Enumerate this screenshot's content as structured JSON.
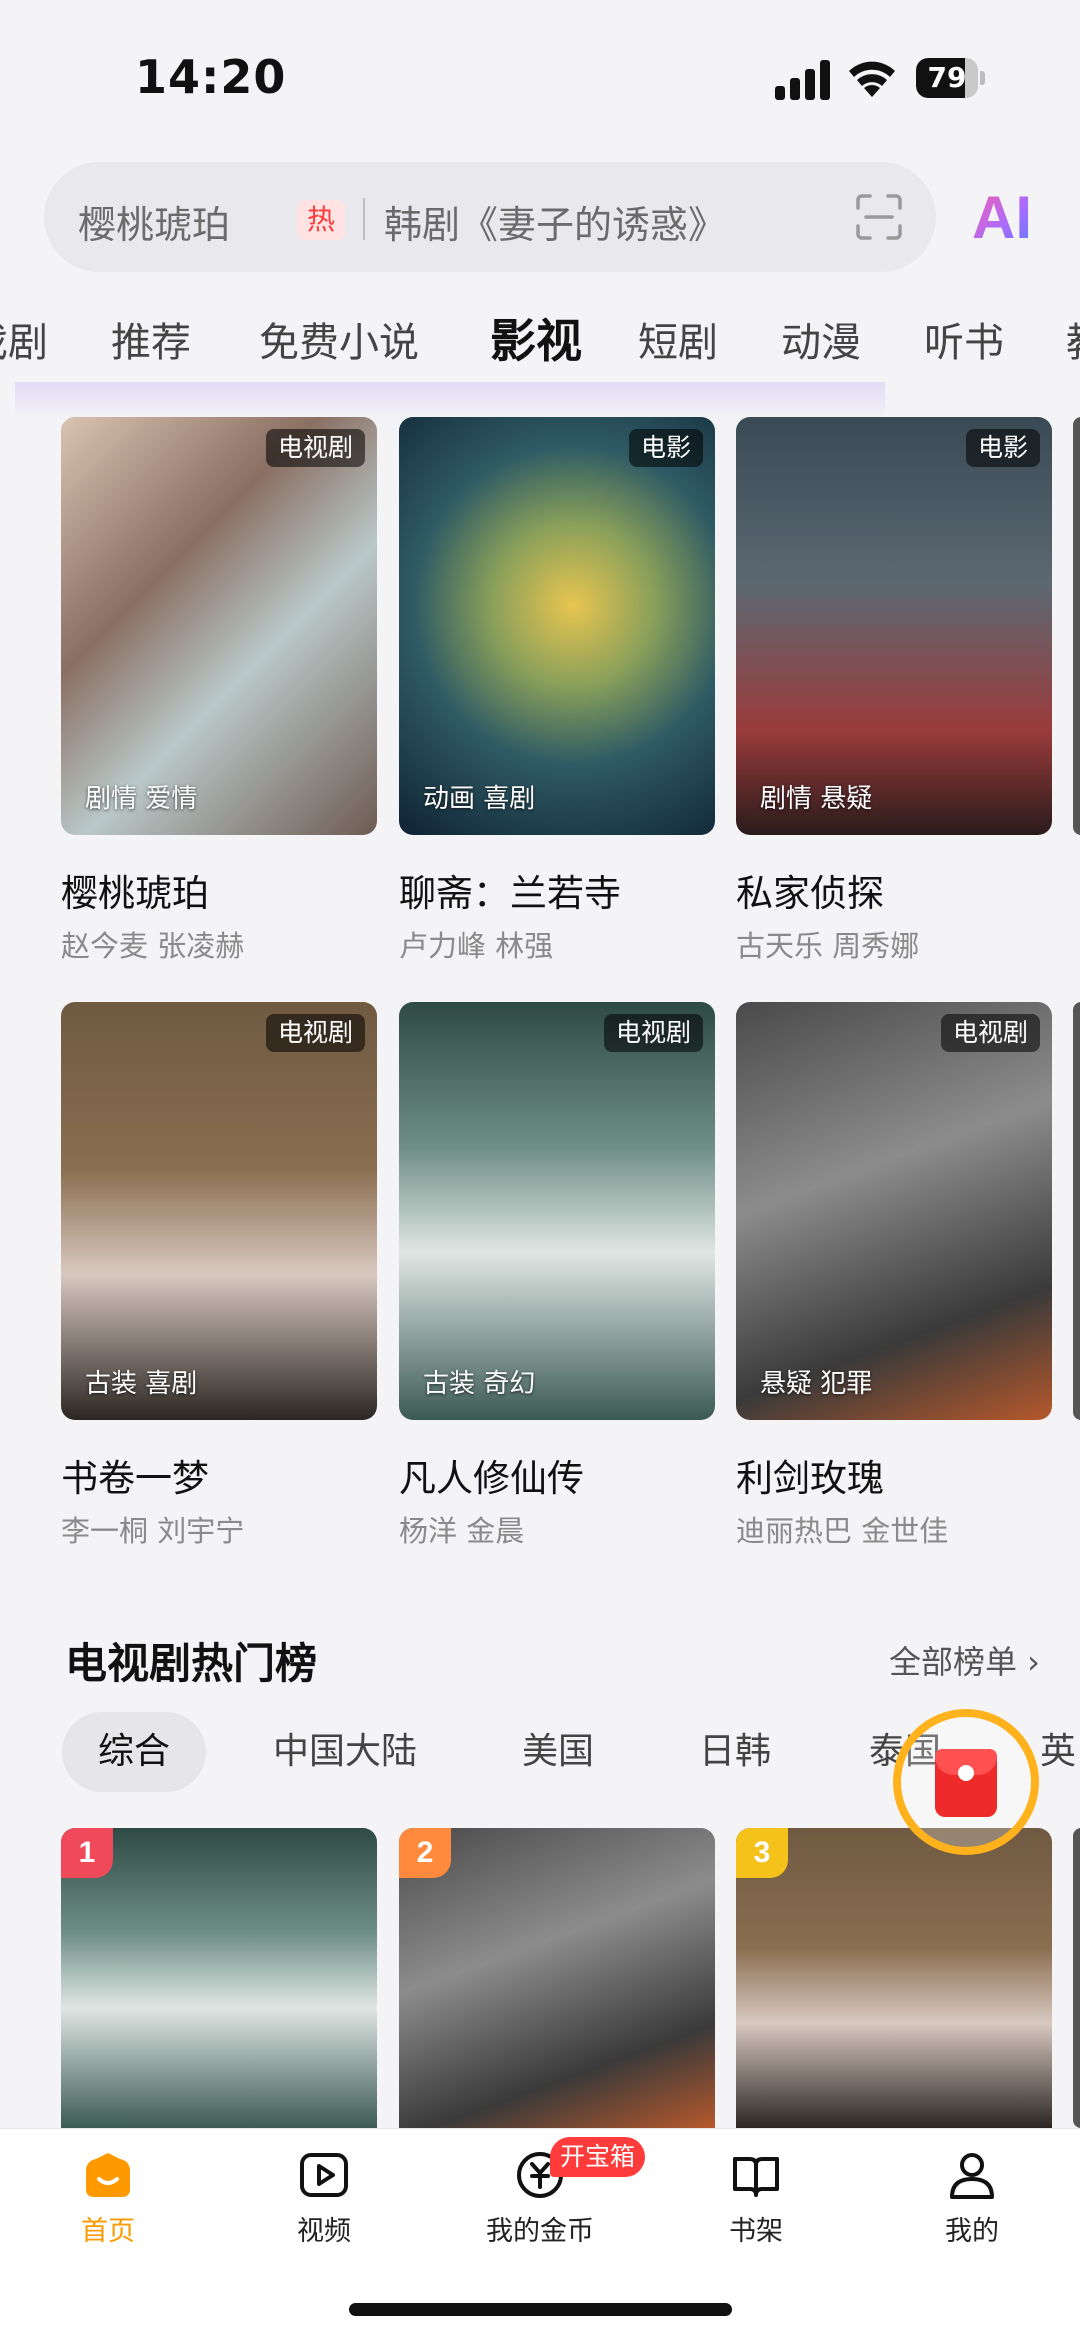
{
  "status_bar": {
    "time": "14:20",
    "battery": "79",
    "battery_level": 0.79
  },
  "search": {
    "main": "樱桃琥珀",
    "hot_badge": "热",
    "sub": "韩剧《妻子的诱惑》",
    "ai_label": "AI"
  },
  "tabs": [
    "戏剧",
    "推荐",
    "免费小说",
    "影视",
    "短剧",
    "动漫",
    "听书",
    "教"
  ],
  "tabs_active_index": 3,
  "cards": [
    {
      "badge": "电视剧",
      "genre": "剧情 爱情",
      "title": "樱桃琥珀",
      "cast": "赵今麦 张凌赫"
    },
    {
      "badge": "电影",
      "genre": "动画 喜剧",
      "title": "聊斋：兰若寺",
      "cast": "卢力峰 林强"
    },
    {
      "badge": "电影",
      "genre": "剧情 悬疑",
      "title": "私家侦探",
      "cast": "古天乐 周秀娜"
    },
    {
      "badge": "电视剧",
      "genre": "古装 喜剧",
      "title": "书卷一梦",
      "cast": "李一桐 刘宇宁"
    },
    {
      "badge": "电视剧",
      "genre": "古装 奇幻",
      "title": "凡人修仙传",
      "cast": "杨洋 金晨"
    },
    {
      "badge": "电视剧",
      "genre": "悬疑 犯罪",
      "title": "利剑玫瑰",
      "cast": "迪丽热巴 金世佳"
    }
  ],
  "ranking": {
    "title": "电视剧热门榜",
    "all_link": "全部榜单 ›",
    "chips": [
      "综合",
      "中国大陆",
      "美国",
      "日韩",
      "泰国",
      "英"
    ],
    "active_chip": 0,
    "items": [
      {
        "rank": "1",
        "color": "#f04a5a"
      },
      {
        "rank": "2",
        "color": "#ff8a3d"
      },
      {
        "rank": "3",
        "color": "#f5c21b"
      }
    ]
  },
  "bottom_nav": [
    {
      "label": "首页",
      "icon": "home-icon",
      "active": true
    },
    {
      "label": "视频",
      "icon": "video-icon"
    },
    {
      "label": "我的金币",
      "icon": "coin-icon",
      "badge": "开宝箱"
    },
    {
      "label": "书架",
      "icon": "bookshelf-icon"
    },
    {
      "label": "我的",
      "icon": "profile-icon"
    }
  ],
  "colors": {
    "accent": "#ff9900",
    "hot_red": "#ff3b3b"
  }
}
